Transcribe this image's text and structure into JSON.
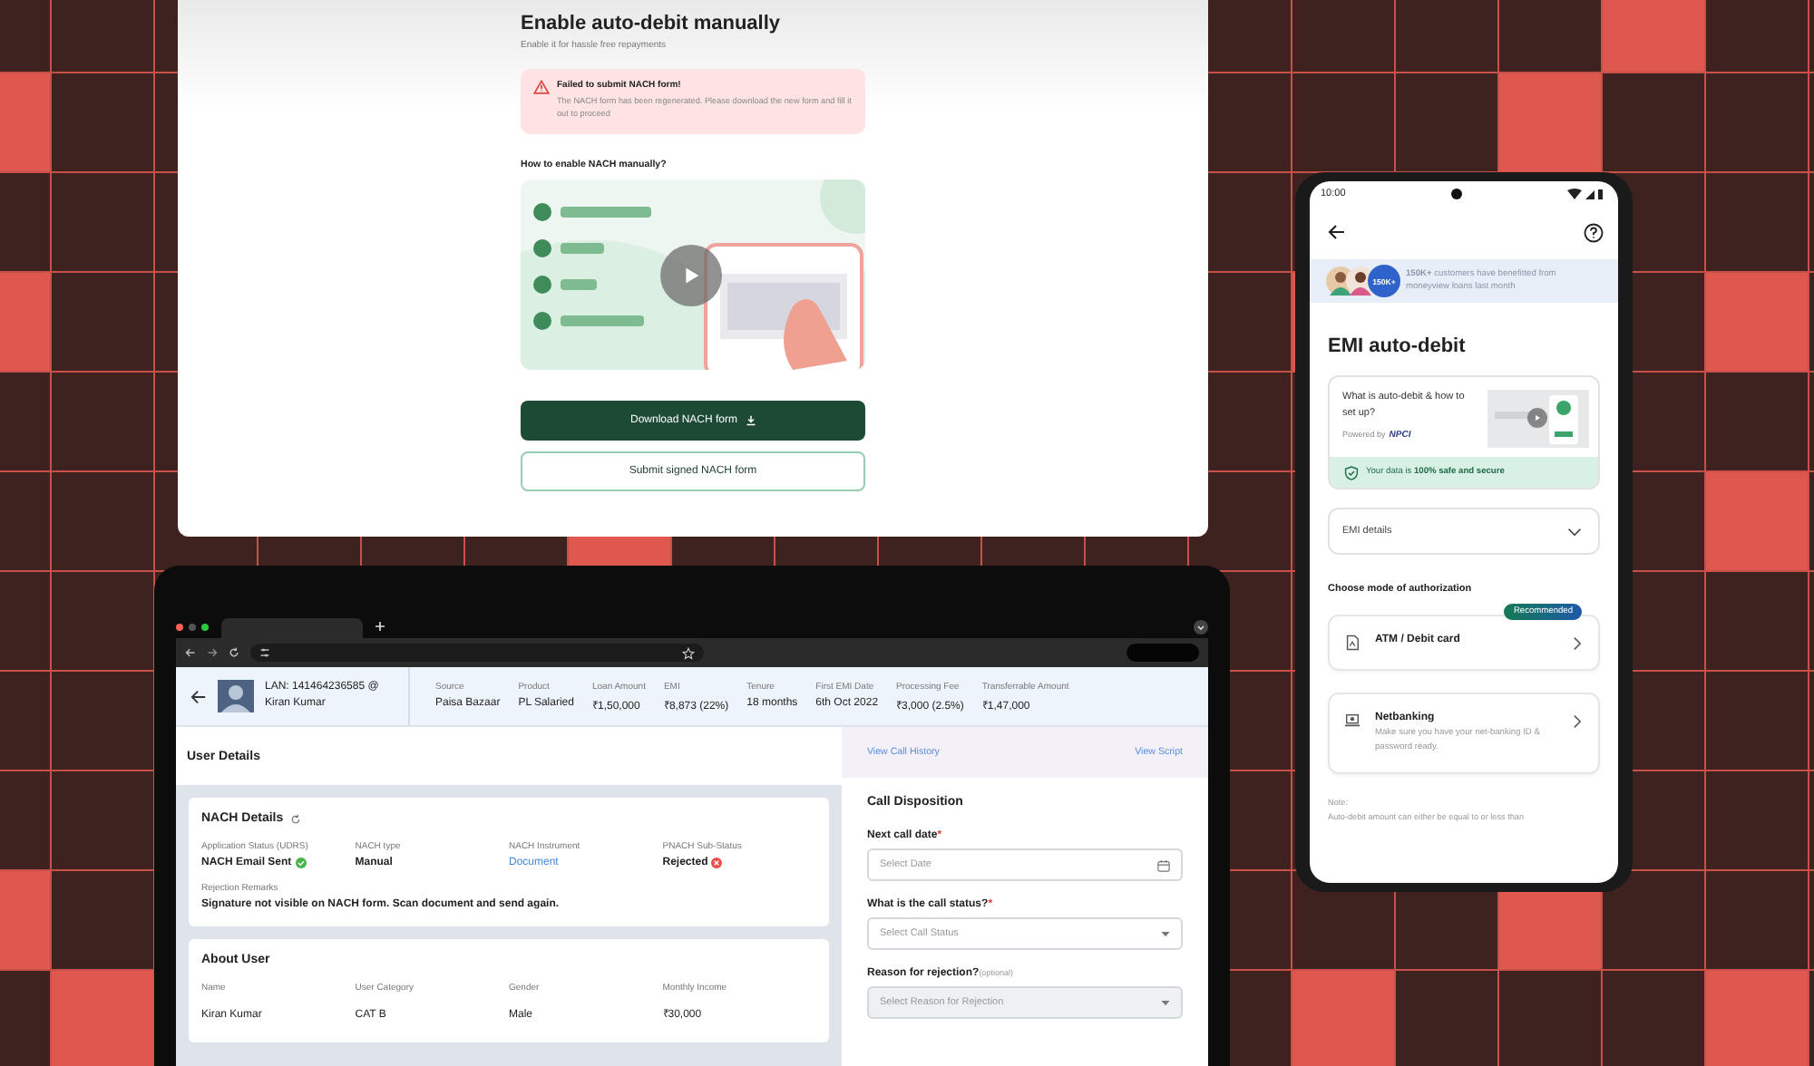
{
  "web_page": {
    "title": "Enable auto-debit manually",
    "subtitle": "Enable it for hassle free repayments",
    "alert": {
      "title": "Failed to submit NACH form!",
      "message": "The NACH form has been regenerated. Please download the new form and fill it out to proceed"
    },
    "howto_heading": "How to enable NACH manually?",
    "buttons": [
      {
        "label": "Download NACH form",
        "kind": "primary"
      },
      {
        "label": "Submit signed NACH form",
        "kind": "secondary"
      }
    ]
  },
  "tablet": {
    "header": {
      "lan": "LAN: 141464236585 @",
      "name": "Kiran Kumar",
      "fields": [
        {
          "label": "Source",
          "value": "Paisa Bazaar"
        },
        {
          "label": "Product",
          "value": "PL Salaried"
        },
        {
          "label": "Loan Amount",
          "value": "₹1,50,000"
        },
        {
          "label": "EMI",
          "value": "₹8,873 (22%)"
        },
        {
          "label": "Tenure",
          "value": "18 months"
        },
        {
          "label": "First EMI Date",
          "value": "6th Oct 2022"
        },
        {
          "label": "Processing Fee",
          "value": "₹3,000 (2.5%)"
        },
        {
          "label": "Transferrable Amount",
          "value": "₹1,47,000"
        }
      ]
    },
    "user_details_title": "User Details",
    "links": [
      "View Call History",
      "View Script"
    ],
    "nach": {
      "title": "NACH Details",
      "fields": [
        {
          "label": "Application Status (UDRS)",
          "value": "NACH Email Sent",
          "kind": "success"
        },
        {
          "label": "NACH type",
          "value": "Manual",
          "kind": "text"
        },
        {
          "label": "NACH Instrument",
          "value": "Document",
          "kind": "link"
        },
        {
          "label": "PNACH Sub-Status",
          "value": "Rejected",
          "kind": "error"
        }
      ],
      "remarks_label": "Rejection Remarks",
      "remarks": "Signature not visible on NACH form. Scan document and send again."
    },
    "about": {
      "title": "About User",
      "fields": [
        {
          "label": "Name",
          "value": "Kiran Kumar"
        },
        {
          "label": "User Category",
          "value": "CAT B"
        },
        {
          "label": "Gender",
          "value": "Male"
        },
        {
          "label": "Monthly Income",
          "value": "₹30,000"
        }
      ]
    },
    "call_disposition": {
      "title": "Call Disposition",
      "fields": [
        {
          "label": "Next call date",
          "required_mark": "*",
          "placeholder": "Select Date",
          "kind": "date",
          "disabled": false
        },
        {
          "label": "What is the call status?",
          "required_mark": "*",
          "placeholder": "Select Call Status",
          "kind": "select",
          "disabled": false
        },
        {
          "label": "Reason for rejection?",
          "hint": "(optional)",
          "placeholder": "Select Reason for Rejection",
          "kind": "select",
          "disabled": true
        }
      ]
    }
  },
  "phone": {
    "time": "10:00",
    "banner": {
      "badge": "150K+",
      "text": "**150K+** customers have benefitted from moneyview loans last month"
    },
    "title": "EMI auto-debit",
    "video_card": {
      "question": "What is auto-debit & how to set up?",
      "powered_by": "Powered by",
      "logo": "NPCI",
      "security": "Your data is **100% safe and secure**"
    },
    "emi_details": "EMI details",
    "auth_heading": "Choose mode of authorization",
    "options": [
      {
        "title": "ATM / Debit card",
        "badge": "Recommended",
        "kind": "card"
      },
      {
        "title": "Netbanking",
        "description": "Make sure you have your net-banking ID & password ready.",
        "kind": "bank"
      }
    ],
    "note_label": "Note:",
    "note": "Auto-debit amount can either be equal to or less than"
  }
}
